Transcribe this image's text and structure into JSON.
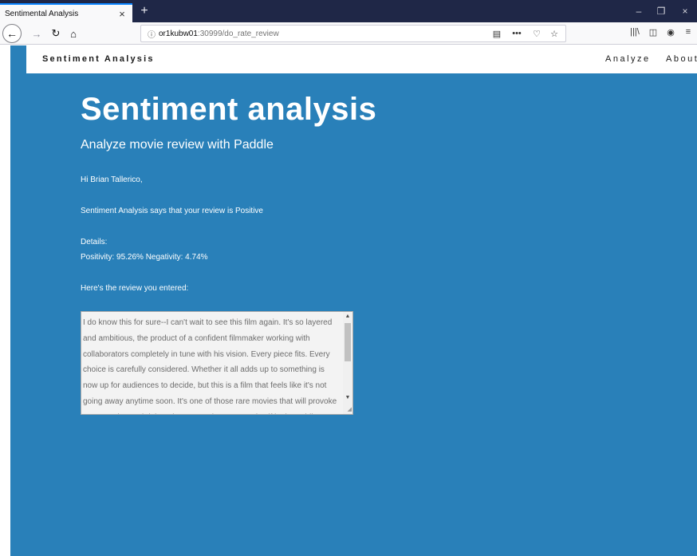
{
  "browser": {
    "tab_title": "Sentimental Analysis",
    "tab_close": "×",
    "new_tab": "+",
    "window_controls": {
      "minimize": "–",
      "restore": "❐",
      "close": "×"
    },
    "nav": {
      "back": "←",
      "forward": "→",
      "reload": "↻",
      "home": "⌂"
    },
    "url": {
      "host": "or1kubw01",
      "path": ":30999/do_rate_review",
      "info_icon": "ⓘ"
    },
    "url_actions": {
      "reader": "▤",
      "more": "•••",
      "pocket": "♡",
      "bookmark": "☆"
    },
    "toolbar": {
      "library": "|||\\",
      "sidebar": "◫",
      "account": "◉",
      "menu": "≡"
    }
  },
  "site": {
    "brand": "Sentiment Analysis",
    "nav_links": [
      "Analyze",
      "About"
    ]
  },
  "hero": {
    "title": "Sentiment analysis",
    "subtitle": "Analyze movie review with Paddle"
  },
  "result": {
    "greeting": "Hi Brian Tallerico,",
    "verdict": "Sentiment Analysis says that your review is Positive",
    "details_label": "Details:",
    "details": "Positivity: 95.26% Negativity: 4.74%",
    "review_label": "Here's the review you entered:",
    "review_text": "I do know this for sure--I can't wait to see this film again. It's so layered and ambitious, the product of a confident filmmaker working with collaborators completely in tune with his vision. Every piece fits. Every choice is carefully considered. Whether it all adds up to something is now up for audiences to decide, but this is a film that feels like it's not going away anytime soon. It's one of those rare movies that will provoke conversation and debate long enough to cement itself in the public"
  },
  "scrollbar": {
    "up": "▲",
    "down": "▼",
    "grip": "◢"
  }
}
